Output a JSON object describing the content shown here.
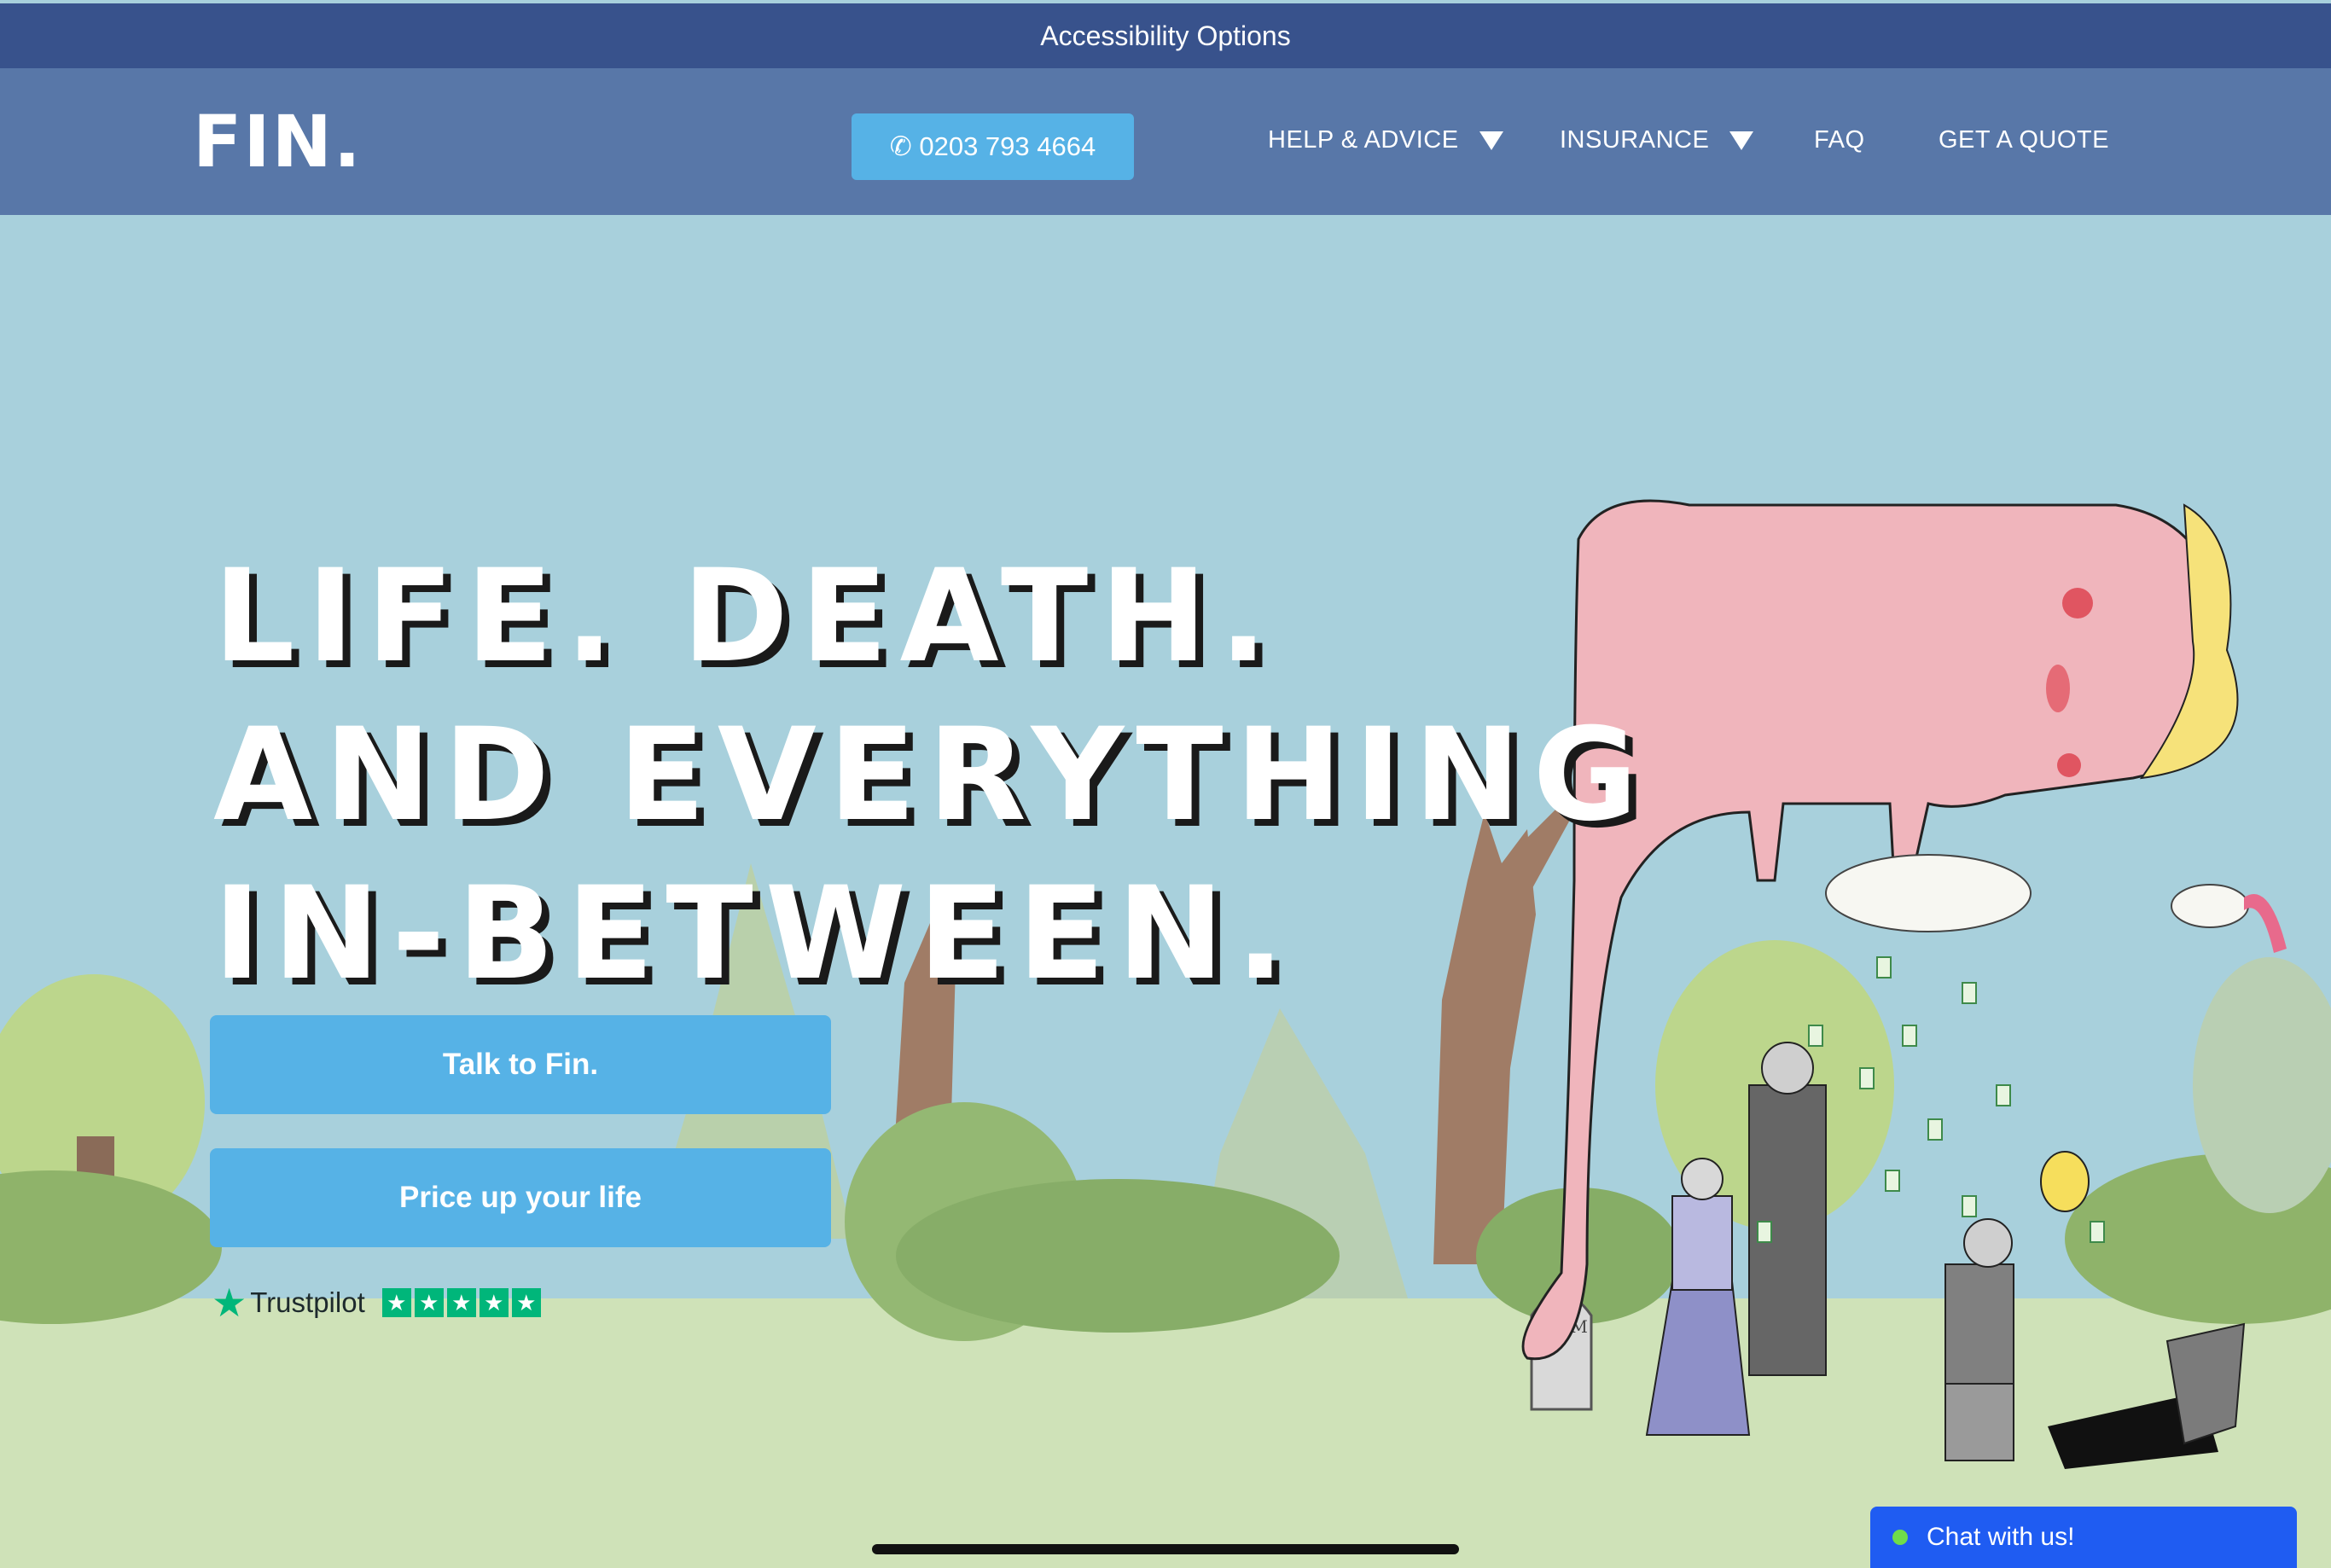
{
  "accessibility_bar": {
    "label": "Accessibility Options"
  },
  "header": {
    "logo": "FIN.",
    "phone": {
      "icon": "phone-icon",
      "number": "✆ 0203 793 4664"
    },
    "nav": [
      {
        "label": "HELP & ADVICE",
        "has_dropdown": true
      },
      {
        "label": "INSURANCE",
        "has_dropdown": true
      },
      {
        "label": "FAQ",
        "has_dropdown": false
      },
      {
        "label": "GET A QUOTE",
        "has_dropdown": false
      }
    ]
  },
  "hero": {
    "headline": [
      "LIFE. DEATH.",
      "AND EVERYTHING",
      "IN-BETWEEN."
    ],
    "primary_cta": "Talk to Fin.",
    "secondary_cta": "Price up your life",
    "trustpilot": {
      "label": "Trustpilot",
      "stars": 5
    }
  },
  "chat": {
    "label": "Chat with us!",
    "status_color": "#6fdd4a"
  },
  "colors": {
    "accessibility_bar": "#38528c",
    "nav": "#5877a8",
    "button": "#56b2e6",
    "sky": "#a8d0dc",
    "grass": "#cfe2b8",
    "chat": "#1f5cf2"
  }
}
